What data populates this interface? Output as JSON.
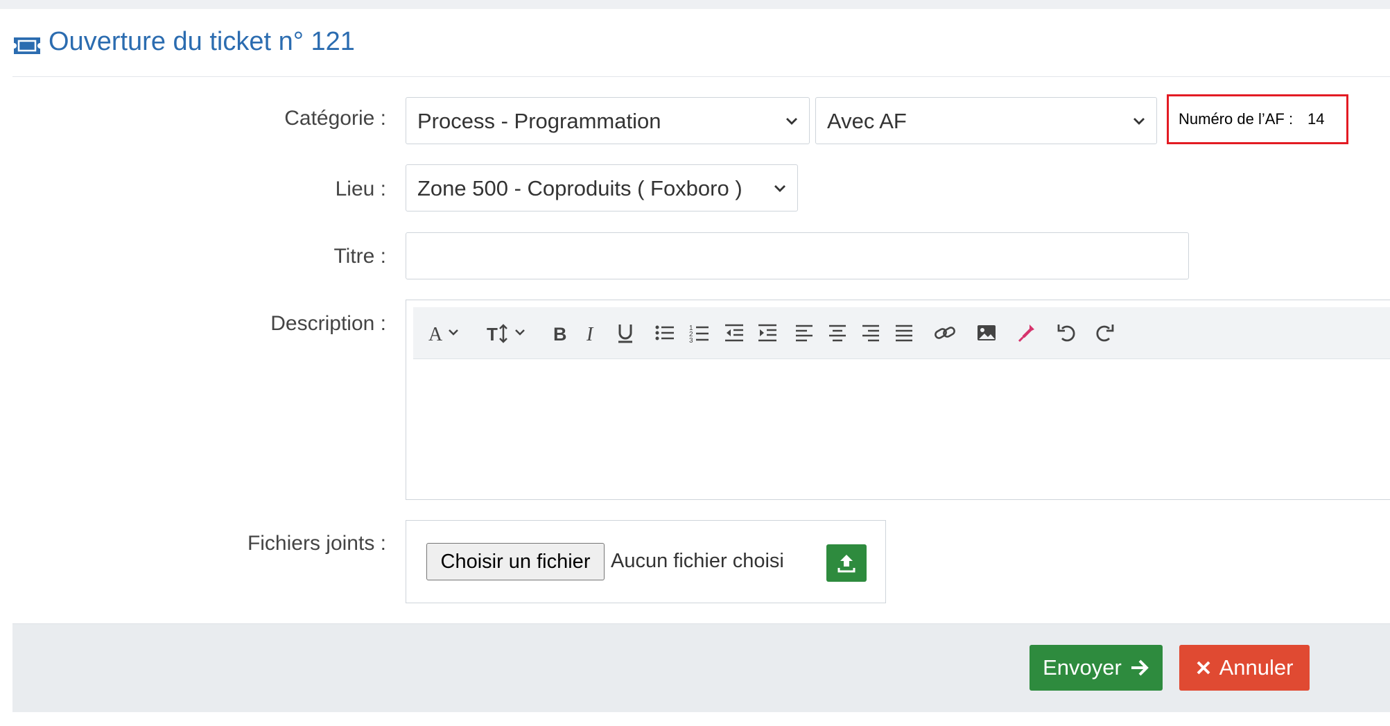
{
  "header": {
    "title": "Ouverture du ticket n° 121",
    "icon": "ticket-icon"
  },
  "form": {
    "category": {
      "label": "Catégorie :",
      "primary_value": "Process - Programmation",
      "secondary_value": "Avec AF"
    },
    "af_number": {
      "label": "Numéro de l’AF :",
      "value": "14"
    },
    "location": {
      "label": "Lieu :",
      "value": "Zone 500 - Coproduits ( Foxboro )"
    },
    "title": {
      "label": "Titre :",
      "value": ""
    },
    "description": {
      "label": "Description :",
      "toolbar": [
        "font-color-icon",
        "font-size-icon",
        "bold-icon",
        "italic-icon",
        "underline-icon",
        "bullet-list-icon",
        "numbered-list-icon",
        "outdent-icon",
        "indent-icon",
        "align-left-icon",
        "align-center-icon",
        "align-right-icon",
        "justify-icon",
        "link-icon",
        "image-icon",
        "color-picker-icon",
        "undo-icon",
        "redo-icon"
      ]
    },
    "attachments": {
      "label": "Fichiers joints :",
      "choose_label": "Choisir un fichier",
      "no_file_text": "Aucun fichier choisi"
    }
  },
  "footer": {
    "send_label": "Envoyer",
    "cancel_label": "Annuler"
  },
  "colors": {
    "accent": "#2b6cb0",
    "success": "#2e8b3e",
    "danger": "#e04a32",
    "highlight_border": "#e31b23"
  }
}
